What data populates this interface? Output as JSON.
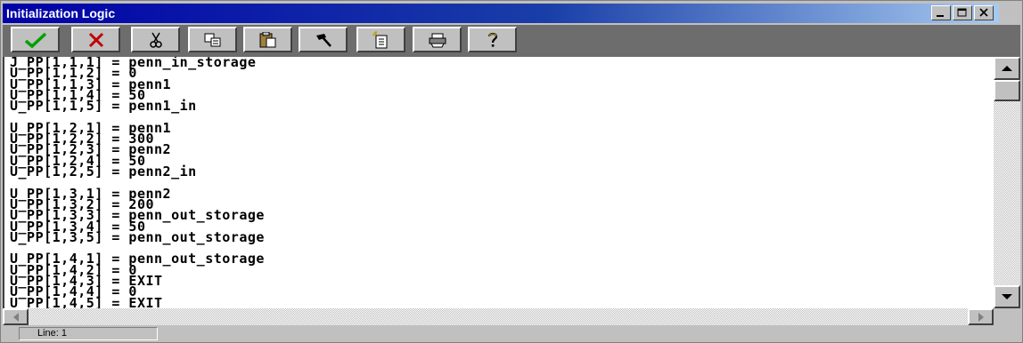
{
  "window": {
    "title": "Initialization Logic",
    "controls": [
      "minimize-icon",
      "maximize-icon",
      "close-icon"
    ]
  },
  "toolbar": {
    "buttons": [
      {
        "name": "ok-button",
        "icon": "checkmark-icon",
        "color": "#00a000"
      },
      {
        "name": "cancel-button",
        "icon": "x-icon",
        "color": "#c00000"
      },
      {
        "name": "cut-button",
        "icon": "scissors-icon"
      },
      {
        "name": "copy-button",
        "icon": "copy-icon"
      },
      {
        "name": "paste-button",
        "icon": "clipboard-icon"
      },
      {
        "name": "build-button",
        "icon": "hammer-icon"
      },
      {
        "name": "new-button",
        "icon": "new-document-icon"
      },
      {
        "name": "print-button",
        "icon": "printer-icon"
      },
      {
        "name": "help-button",
        "icon": "question-mark-icon"
      }
    ]
  },
  "editor": {
    "lines": [
      "J_PP[1,1,1] = penn_in_storage",
      "U_PP[1,1,2] = 0",
      "U_PP[1,1,3] = penn1",
      "U_PP[1,1,4] = 50",
      "U_PP[1,1,5] = penn1_in",
      "",
      "U_PP[1,2,1] = penn1",
      "U_PP[1,2,2] = 300",
      "U_PP[1,2,3] = penn2",
      "U_PP[1,2,4] = 50",
      "U_PP[1,2,5] = penn2_in",
      "",
      "U_PP[1,3,1] = penn2",
      "U_PP[1,3,2] = 200",
      "U_PP[1,3,3] = penn_out_storage",
      "U_PP[1,3,4] = 50",
      "U_PP[1,3,5] = penn_out_storage",
      "",
      "U_PP[1,4,1] = penn_out_storage",
      "U_PP[1,4,2] = 0",
      "U_PP[1,4,3] = EXIT",
      "U_PP[1,4,4] = 0",
      "U_PP[1,4,5] = EXIT"
    ]
  },
  "status": {
    "line_label": "Line: 1"
  }
}
